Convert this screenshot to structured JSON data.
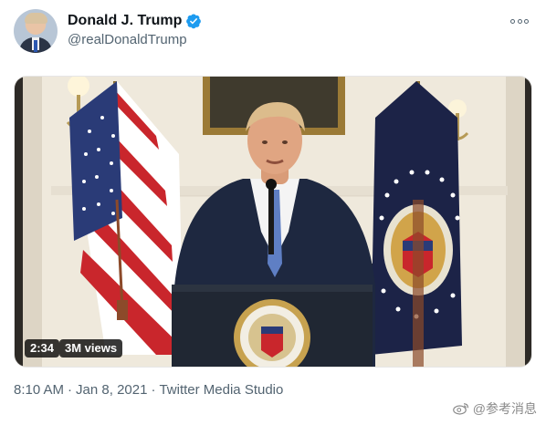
{
  "author": {
    "name": "Donald J. Trump",
    "handle": "@realDonaldTrump",
    "verified": true
  },
  "media": {
    "duration": "2:34",
    "views": "3M views"
  },
  "footer": {
    "time": "8:10 AM",
    "separator1": "·",
    "date": "Jan 8, 2021",
    "separator2": "·",
    "source": "Twitter Media Studio"
  },
  "watermark": {
    "text": "@参考消息"
  },
  "icons": {
    "verified": "verified-badge-icon",
    "more": "more-options-icon",
    "weibo": "weibo-icon"
  },
  "colors": {
    "verified_blue": "#1d9bf0",
    "text_secondary": "#536471"
  }
}
